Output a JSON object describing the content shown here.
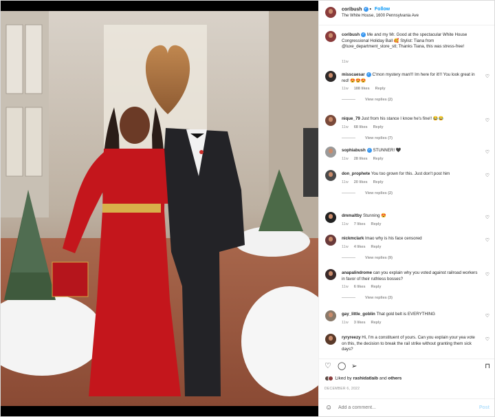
{
  "header": {
    "username": "coribush",
    "follow_label": "Follow",
    "location": "The White House, 1600 Pennsylvania Ave"
  },
  "caption": {
    "username": "coribush",
    "text": "Me and my Mr. Good at the spectacular White House Congressional Holiday Ball 🥰 Stylist: Tiana from @luxe_department_store_stl; Thanks Tiana, this was stress-free!",
    "time": "11w"
  },
  "comments": [
    {
      "username": "misscaesar",
      "verified": true,
      "text": "C'mon mystery man!!! Im here for it!!! You look great in red! 😍😍😍",
      "time": "11w",
      "likes": "188 likes",
      "reply": "Reply",
      "view_replies": "View replies (2)"
    },
    {
      "username": "nique_79",
      "verified": false,
      "text": "Just from his stance I know he's fine!! 😂😂",
      "time": "11w",
      "likes": "68 likes",
      "reply": "Reply",
      "view_replies": "View replies (7)"
    },
    {
      "username": "sophiabush",
      "verified": true,
      "text": "STUNNER! 🖤",
      "time": "11w",
      "likes": "28 likes",
      "reply": "Reply",
      "view_replies": ""
    },
    {
      "username": "don_prophete",
      "verified": false,
      "text": "You too grown for this. Just don't post him",
      "time": "11w",
      "likes": "20 likes",
      "reply": "Reply",
      "view_replies": "View replies (2)"
    },
    {
      "username": "dmmaltby",
      "verified": false,
      "text": "Stunning 😍",
      "time": "11w",
      "likes": "7 likes",
      "reply": "Reply",
      "view_replies": ""
    },
    {
      "username": "nickmclark",
      "verified": false,
      "text": "lmao why is his face censored",
      "time": "11w",
      "likes": "4 likes",
      "reply": "Reply",
      "view_replies": "View replies (9)"
    },
    {
      "username": "anapalindrome",
      "verified": false,
      "text": "can you explain why you voted against railroad workers in favor of their ruthless bosses?",
      "time": "11w",
      "likes": "6 likes",
      "reply": "Reply",
      "view_replies": "View replies (3)"
    },
    {
      "username": "gay_little_goblin",
      "verified": false,
      "text": "That gold belt is EVERYTHING",
      "time": "11w",
      "likes": "3 likes",
      "reply": "Reply",
      "view_replies": ""
    },
    {
      "username": "ryryreezy",
      "verified": false,
      "text": "Hi, I'm a constituent of yours. Can you explain your yea vote on this, the decision to break the rail strike without granting them sick days?",
      "time": "",
      "likes": "",
      "reply": "",
      "view_replies": ""
    }
  ],
  "liked_by": {
    "prefix": "Liked by",
    "user": "rashidatlaib",
    "and": "and",
    "others": "others"
  },
  "date": "DECEMBER 6, 2022",
  "add_comment": {
    "placeholder": "Add a comment...",
    "post_label": "Post"
  },
  "icons": {
    "like": "heart-icon",
    "comment": "comment-bubble-icon",
    "share": "paper-plane-icon",
    "save": "bookmark-icon",
    "emoji": "smiley-icon",
    "more": "more-dots-icon"
  },
  "colors": {
    "link_blue": "#0095f6",
    "dress_red": "#c4161c",
    "text": "#262626",
    "muted": "#8e8e8e"
  }
}
